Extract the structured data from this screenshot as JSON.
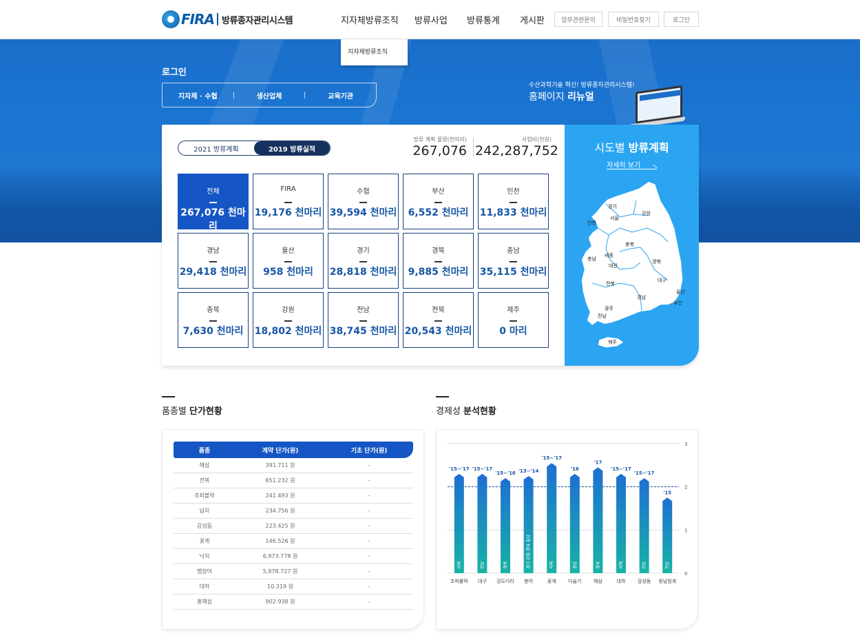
{
  "header": {
    "logo_text": "FIRA",
    "logo_sub": "방류종자관리시스템",
    "nav": [
      "지자체방류조직",
      "방류사업",
      "방류통계",
      "게시판"
    ],
    "util": [
      "업무관련문의",
      "비밀번호찾기",
      "로그인"
    ],
    "submenu": [
      "지자체방류조직"
    ]
  },
  "hero": {
    "title": "로그인",
    "login_tabs": [
      "지자체 · 수협",
      "생산업체",
      "교육기관"
    ],
    "promo_line1": "수산과학기술 혁신! 방류종자관리시스템!",
    "promo_line2_pre": "홈페이지 ",
    "promo_line2_bold": "리뉴얼"
  },
  "panel": {
    "toggle": [
      "2021 방류계획",
      "2019 방류실적"
    ],
    "summary": [
      {
        "label": "방류 계획 물량(천마리)",
        "value": "267,076"
      },
      {
        "label": "사업비(천원)",
        "value": "242,287,752"
      }
    ],
    "regions": [
      {
        "name": "전체",
        "value": "267,076 천마리"
      },
      {
        "name": "FIRA",
        "value": "19,176 천마리"
      },
      {
        "name": "수협",
        "value": "39,594 천마리"
      },
      {
        "name": "부산",
        "value": "6,552 천마리"
      },
      {
        "name": "인천",
        "value": "11,833 천마리"
      },
      {
        "name": "경남",
        "value": "29,418 천마리"
      },
      {
        "name": "울산",
        "value": "958 천마리"
      },
      {
        "name": "경기",
        "value": "28,818 천마리"
      },
      {
        "name": "경북",
        "value": "9,885 천마리"
      },
      {
        "name": "충남",
        "value": "35,115 천마리"
      },
      {
        "name": "충북",
        "value": "7,630 천마리"
      },
      {
        "name": "강원",
        "value": "18,802 천마리"
      },
      {
        "name": "전남",
        "value": "38,745 천마리"
      },
      {
        "name": "전북",
        "value": "20,543 천마리"
      },
      {
        "name": "제주",
        "value": "0 마리"
      }
    ],
    "map": {
      "title_pre": "시도별 ",
      "title_bold": "방류계획",
      "more": "자세히 보기",
      "labels": [
        "경기",
        "서울",
        "인천",
        "강원",
        "충북",
        "세종",
        "대전",
        "충남",
        "경북",
        "대구",
        "울산",
        "전북",
        "경남",
        "부산",
        "광주",
        "전남",
        "제주"
      ]
    }
  },
  "price": {
    "title_pre": "품종별 ",
    "title_bold": "단가현황",
    "headers": [
      "품종",
      "계약 단가(원)",
      "기초 단가(원)"
    ],
    "rows": [
      [
        "해삼",
        "391.711 원",
        "-"
      ],
      [
        "전복",
        "651.232 원",
        "-"
      ],
      [
        "조피볼락",
        "241.493 원",
        "-"
      ],
      [
        "넙치",
        "234.756 원",
        "-"
      ],
      [
        "감성돔",
        "223.425 원",
        "-"
      ],
      [
        "꽃게",
        "146.526 원",
        "-"
      ],
      [
        "낙지",
        "6,973.778 원",
        "-"
      ],
      [
        "뱀장어",
        "5,878.727 원",
        "-"
      ],
      [
        "대하",
        "10.319 원",
        "-"
      ],
      [
        "홍해삼",
        "902.938 원",
        "-"
      ]
    ]
  },
  "econ": {
    "title_pre": "경제성 ",
    "title_bold": "분석현황"
  },
  "chart_data": {
    "type": "bar",
    "categories": [
      "조피볼락",
      "대구",
      "강도다리",
      "붕어",
      "꽃게",
      "다슬기",
      "해삼",
      "대하",
      "감성돔",
      "동남참게"
    ],
    "values": [
      2.3,
      2.3,
      2.2,
      2.25,
      2.55,
      2.3,
      2.45,
      2.3,
      2.2,
      1.75
    ],
    "period_labels": [
      "'15~'17",
      "'15~'17",
      "'15~'16",
      "'13~'14",
      "'15~'17",
      "'16",
      "'17",
      "'15~'17",
      "'15~'17",
      "'15"
    ],
    "bar_notes": [
      "서해",
      "전남",
      "경북",
      "경기 강원 경북 충남",
      "서해",
      "경남",
      "경북",
      "서해",
      "전남",
      "전남"
    ],
    "yticks": [
      0,
      1,
      2,
      3
    ],
    "ylim": [
      0,
      3
    ],
    "reference_line": 2,
    "colors": {
      "bar_top": "#1f6fd1",
      "bar_bottom": "#17b3a6"
    }
  }
}
